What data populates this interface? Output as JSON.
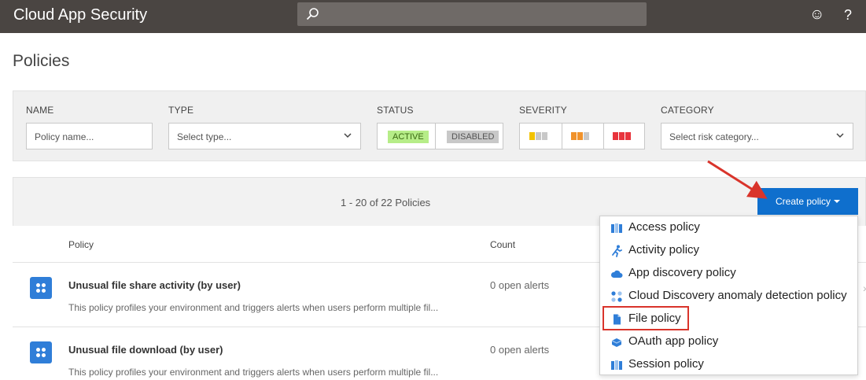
{
  "app": {
    "title": "Cloud App Security"
  },
  "header": {
    "search_placeholder": "",
    "icons": [
      "search-icon",
      "smiley-icon",
      "help-icon"
    ],
    "help_glyph": "?",
    "smiley_glyph": "☺"
  },
  "page": {
    "title": "Policies"
  },
  "filters": {
    "name_label": "NAME",
    "name_placeholder": "Policy name...",
    "type_label": "TYPE",
    "type_value": "Select type...",
    "status_label": "STATUS",
    "status_active": "ACTIVE",
    "status_disabled": "DISABLED",
    "severity_label": "SEVERITY",
    "category_label": "CATEGORY",
    "category_value": "Select risk category...",
    "colors": {
      "active_bg": "#b6ed88",
      "low": "#f2c200",
      "medium": "#f0922b",
      "high": "#e8343d",
      "inactive_sq": "#c8c8c8"
    }
  },
  "list": {
    "count_text": "1 - 20 of 22 Policies",
    "create_button": "Create policy",
    "columns": {
      "policy": "Policy",
      "count": "Count"
    },
    "rows": [
      {
        "title": "Unusual file share activity (by user)",
        "description": "This policy profiles your environment and triggers alerts when users perform multiple fil...",
        "count": "0 open alerts"
      },
      {
        "title": "Unusual file download (by user)",
        "description": "This policy profiles your environment and triggers alerts when users perform multiple fil...",
        "count": "0 open alerts"
      }
    ]
  },
  "menu": {
    "items": [
      {
        "label": "Access policy",
        "icon": "access-policy-icon"
      },
      {
        "label": "Activity policy",
        "icon": "activity-policy-icon"
      },
      {
        "label": "App discovery policy",
        "icon": "cloud-icon"
      },
      {
        "label": "Cloud Discovery anomaly detection policy",
        "icon": "anomaly-icon"
      },
      {
        "label": "File policy",
        "icon": "file-icon"
      },
      {
        "label": "OAuth app policy",
        "icon": "oauth-icon"
      },
      {
        "label": "Session policy",
        "icon": "session-policy-icon"
      }
    ],
    "highlighted": "File policy"
  },
  "accent": {
    "primary": "#0f6fcd",
    "annotation": "#d9342b"
  }
}
